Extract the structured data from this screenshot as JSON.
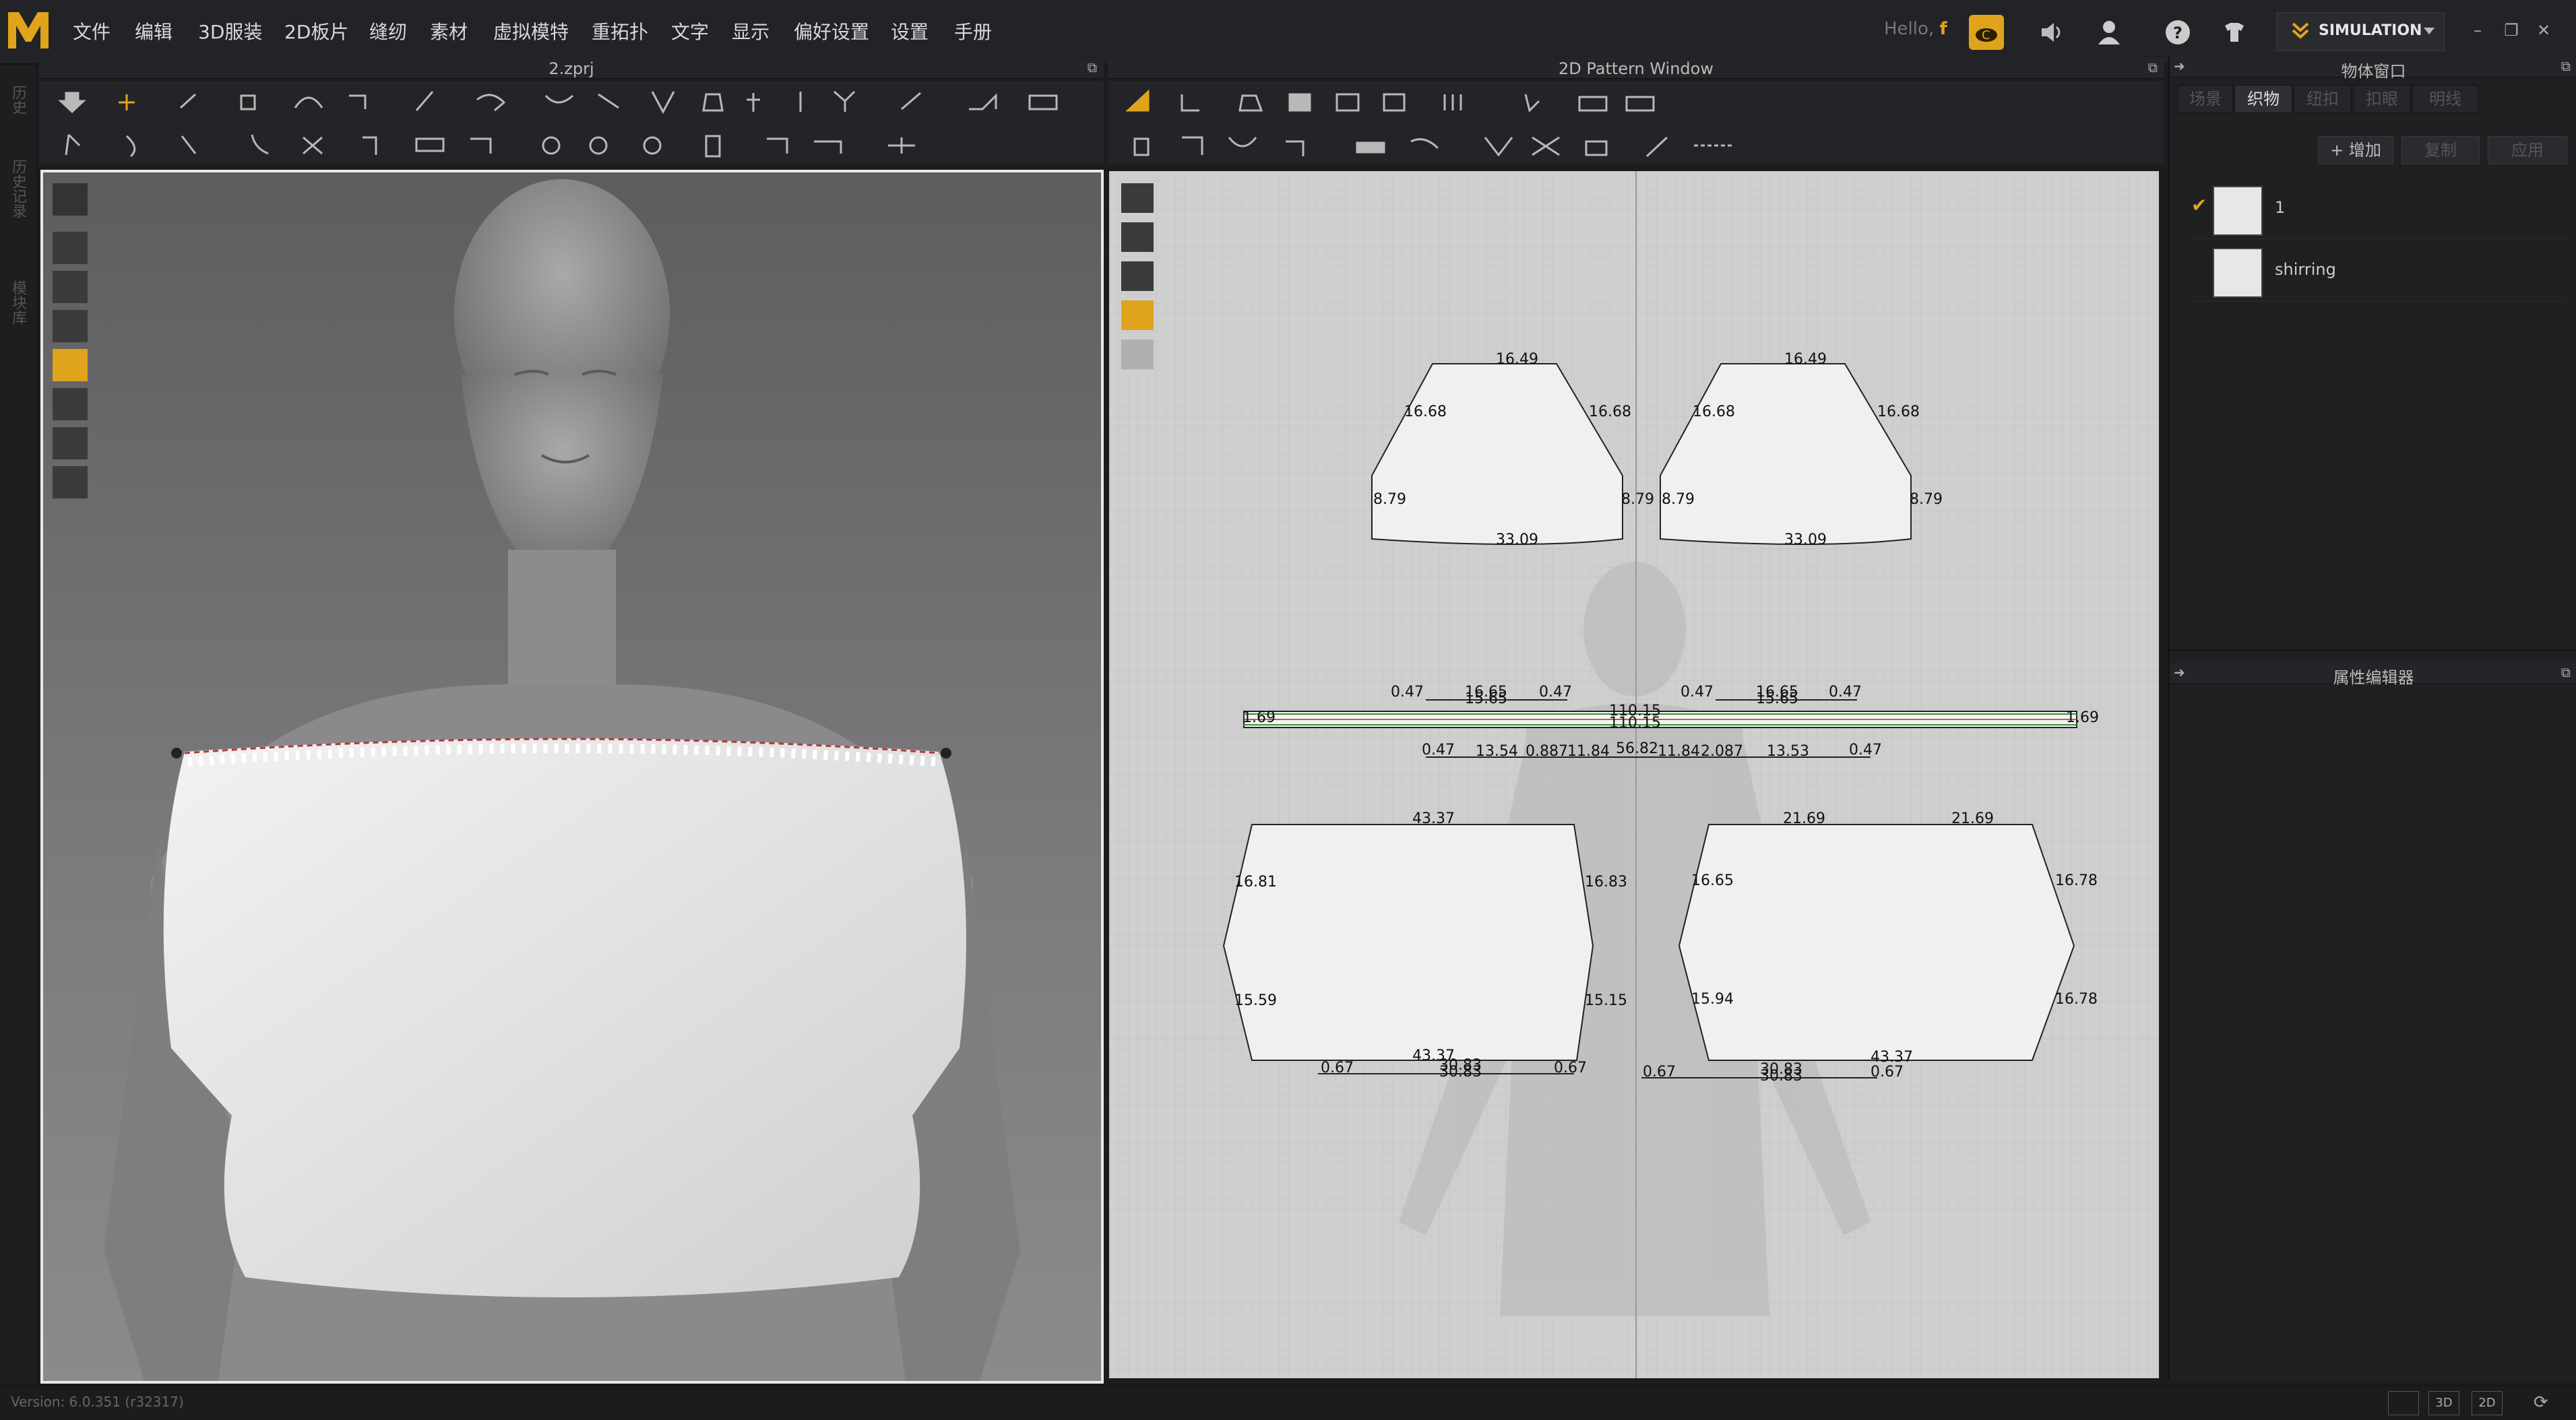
{
  "app": {
    "logo_letter": "M",
    "accent": "#e0a31c",
    "menu": [
      "文件",
      "编辑",
      "3D服装",
      "2D板片",
      "缝纫",
      "素材",
      "虚拟模特",
      "重拓扑",
      "文字",
      "显示",
      "偏好设置",
      "设置",
      "手册"
    ],
    "hello_prefix": "Hello,",
    "user_initial": "f",
    "mode_label": "SIMULATION"
  },
  "panels": {
    "viewport3d_title": "2.zprj",
    "pattern_title": "2D Pattern Window",
    "object_window_title": "物体窗口",
    "property_editor_title": "属性编辑器"
  },
  "left_strip": [
    "历史",
    "历史记录",
    "模块库"
  ],
  "object_window": {
    "tabs": [
      "场景",
      "织物",
      "纽扣",
      "扣眼",
      "明线"
    ],
    "active_tab": "织物",
    "buttons": {
      "add": "+ 增加",
      "copy": "复制",
      "apply": "应用"
    },
    "fabrics": [
      {
        "name": "1",
        "selected": true,
        "color": "#e7e7e7"
      },
      {
        "name": "shirring",
        "selected": false,
        "color": "#e7e7e7"
      }
    ]
  },
  "pattern_labels": {
    "sleeve_left": [
      "16.49",
      "16.68",
      "16.68",
      "8.79",
      "8.79",
      "33.09"
    ],
    "sleeve_right": [
      "16.49",
      "16.68",
      "16.68",
      "8.79",
      "8.79",
      "33.09"
    ],
    "band": [
      "0.47",
      "16.65",
      "15.65",
      "0.47",
      "0.47",
      "16.65",
      "15.65",
      "0.47",
      "110.15",
      "110.15",
      "1.69",
      "1.69"
    ],
    "band_lower": [
      "0.47",
      "13.54",
      "0.887",
      "11.84",
      "56.82",
      "11.84",
      "2.087",
      "13.53",
      "0.47"
    ],
    "front": [
      "43.37",
      "16.81",
      "16.83",
      "15.59",
      "15.15",
      "43.37"
    ],
    "back": [
      "21.69",
      "21.69",
      "16.65",
      "16.78",
      "15.94",
      "16.78",
      "43.37"
    ],
    "front_hem": [
      "0.67",
      "30.83",
      "30.83",
      "0.67"
    ],
    "back_hem": [
      "0.67",
      "30.83",
      "30.83",
      "0.67"
    ]
  },
  "status": {
    "version": "Version: 6.0.351 (r32317)",
    "view_buttons": [
      "",
      "3D",
      "2D"
    ]
  }
}
